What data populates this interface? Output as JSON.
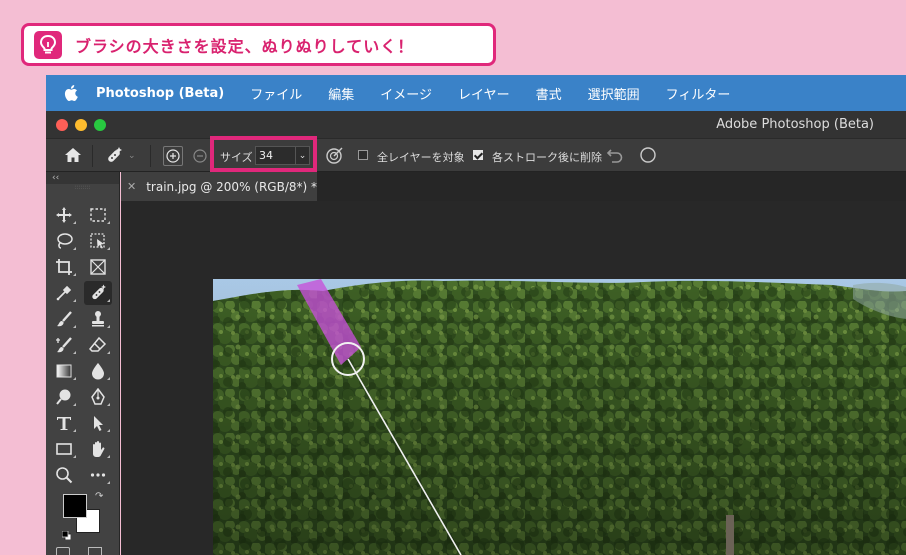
{
  "tip": {
    "text": "ブラシの大きさを設定、ぬりぬりしていく！",
    "icon": "lightbulb-icon",
    "color": "#e0287b"
  },
  "menubar": {
    "app_name": "Photoshop (Beta)",
    "items": [
      "ファイル",
      "編集",
      "イメージ",
      "レイヤー",
      "書式",
      "選択範囲",
      "フィルター"
    ],
    "background": "#3a82c8"
  },
  "window": {
    "title": "Adobe Photoshop (Beta)"
  },
  "options_bar": {
    "size_label": "サイズ",
    "size_value": "34",
    "all_layers_label": "全レイヤーを対象",
    "all_layers_checked": false,
    "delete_after_stroke_label": "各ストローク後に削除",
    "delete_after_stroke_checked": true
  },
  "toolbar": {
    "collapse_label": "‹‹",
    "tools": [
      "move-tool-icon",
      "marquee-tool-icon",
      "lasso-tool-icon",
      "object-select-tool-icon",
      "crop-tool-icon",
      "frame-tool-icon",
      "eyedropper-tool-icon",
      "remove-tool-icon",
      "brush-tool-icon",
      "stamp-tool-icon",
      "history-brush-tool-icon",
      "eraser-tool-icon",
      "gradient-tool-icon",
      "blur-tool-icon",
      "dodge-tool-icon",
      "pen-tool-icon",
      "type-tool-icon",
      "path-select-tool-icon",
      "rectangle-tool-icon",
      "hand-tool-icon",
      "zoom-tool-icon",
      "more-tools-icon"
    ],
    "active_tool": "remove-tool-icon"
  },
  "document": {
    "tab_label": "train.jpg @ 200% (RGB/8*) *"
  },
  "brush_stroke_color": "#c74fd8"
}
